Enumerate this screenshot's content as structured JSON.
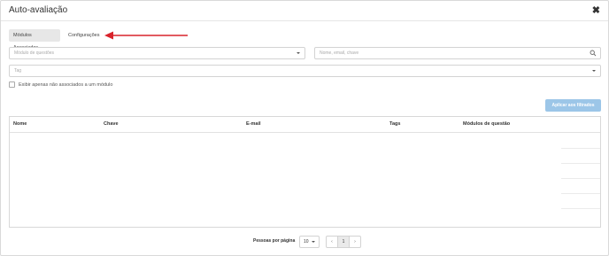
{
  "modal": {
    "title": "Auto-avaliação",
    "close_glyph": "✖"
  },
  "tabs": [
    {
      "label": "Módulos Associados",
      "active": true
    },
    {
      "label": "Configurações",
      "active": false
    }
  ],
  "filters": {
    "modulo_placeholder": "Módulo de questões",
    "search_placeholder": "Nome, email, chave",
    "tag_placeholder": "Tag",
    "checkbox_label": "Exibir apenas não associados a um módulo",
    "checkbox_checked": false
  },
  "actions": {
    "apply_label": "Aplicar aos filtrados"
  },
  "table": {
    "columns": [
      "Nome",
      "Chave",
      "E-mail",
      "Tags",
      "Módulos de questão"
    ],
    "rows": []
  },
  "pagination": {
    "per_page_label": "Pessoas por página",
    "per_page_value": "10",
    "prev": "‹",
    "current_page": "1",
    "next": "›"
  },
  "annotation": {
    "arrow_color": "#d9232b"
  },
  "colors": {
    "accent_button": "#9cc6e8",
    "active_tab_bg": "#e7e7e7"
  }
}
